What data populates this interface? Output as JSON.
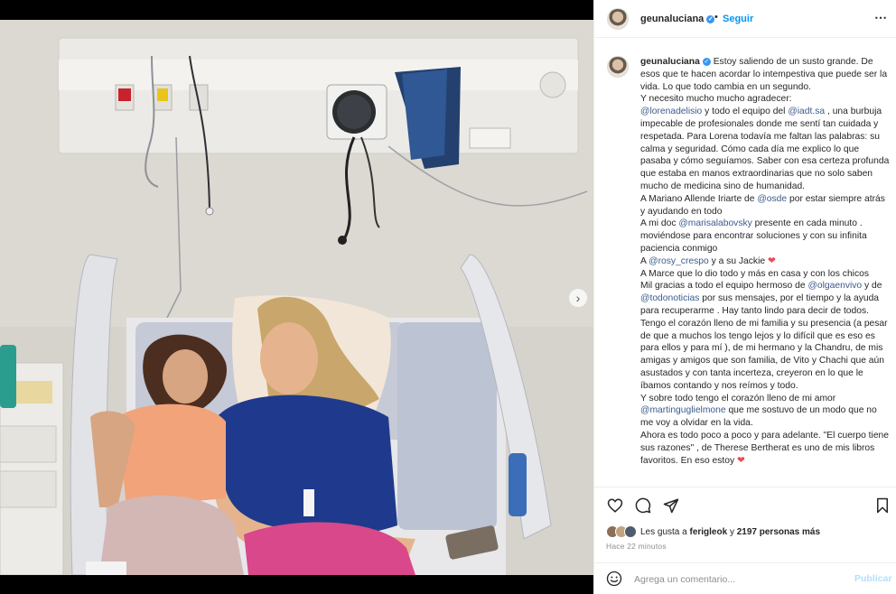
{
  "header": {
    "username": "geunaluciana",
    "dot": "•",
    "follow_label": "Seguir",
    "more_icon": "⋯"
  },
  "caption": {
    "username": "geunaluciana",
    "lines": [
      [
        "Estoy saliendo de un susto grande. De esos que te hacen acordar lo intempestiva que puede ser la vida. Lo que todo cambia en un segundo."
      ],
      [
        "Y necesito mucho mucho agradecer:"
      ],
      [
        {
          "m": "@lorenadelisio"
        },
        " y todo el equipo del ",
        {
          "m": "@iadt.sa"
        },
        " , una burbuja impecable de profesionales donde me sentí tan cuidada y respetada. Para Lorena todavía me faltan las palabras: su calma y seguridad. Cómo cada día me explico lo que pasaba y cómo seguíamos. Saber con esa certeza profunda que estaba en manos extraordinarias que no solo saben mucho de medicina sino de humanidad."
      ],
      [
        "A Mariano Allende Iriarte de ",
        {
          "m": "@osde"
        },
        " por estar siempre atrás y ayudando en todo"
      ],
      [
        "A mi doc ",
        {
          "m": "@marisalabovsky"
        },
        " presente en cada minuto . moviéndose para encontrar soluciones y con su infinita paciencia conmigo"
      ],
      [
        "A ",
        {
          "m": "@rosy_crespo"
        },
        " y a su Jackie ",
        {
          "h": "❤"
        }
      ],
      [
        "A Marce que lo dio todo y más en casa y con los chicos"
      ],
      [
        "Mil gracias a todo el equipo hermoso de ",
        {
          "m": "@olgaenvivo"
        },
        " y de ",
        {
          "m": "@todonoticias"
        },
        " por sus mensajes, por el tiempo y la ayuda para recuperarme . Hay tanto lindo para decir de todos."
      ],
      [
        "Tengo el corazón lleno de mi familia y su presencia (a pesar de que a muchos los tengo lejos y lo difícil que es eso es para ellos y para mí ), de mi hermano y la Chandru, de mis amigas y amigos que son familia, de Vito y Chachi que aún asustados y con tanta incerteza, creyeron en lo que le íbamos contando y nos reímos y todo."
      ],
      [
        "Y sobre todo tengo el corazón lleno de mi amor ",
        {
          "m": "@martingugliel­mone"
        },
        " que me sostuvo de un modo que no me voy a olvidar en la vida."
      ],
      [
        "Ahora es todo poco a poco y para adelante. \"El cuerpo tiene sus razones\" , de Therese Bertherat es uno de mis libros favoritos. En eso estoy ",
        {
          "h": "❤"
        }
      ]
    ]
  },
  "actions": {
    "like_icon": "heart-icon",
    "comment_icon": "comment-icon",
    "share_icon": "share-icon",
    "save_icon": "bookmark-icon"
  },
  "likes": {
    "prefix": "Les gusta a ",
    "user": "ferigleok",
    "middle": " y ",
    "count": "2197 personas más"
  },
  "time": "Hace 22 minutos",
  "comment": {
    "placeholder": "Agrega un comentario...",
    "publish_label": "Publicar"
  },
  "colors": {
    "accent": "#0095f6",
    "mention": "#3b5b8c",
    "heart": "#ed4956",
    "publish_disabled": "#b2dffc"
  }
}
